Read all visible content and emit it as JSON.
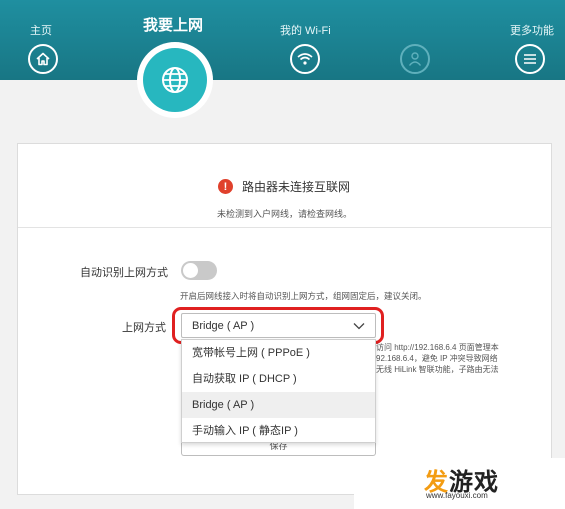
{
  "nav": {
    "home_label": "主页",
    "internet_label": "我要上网",
    "wifi_label": "我的 Wi-Fi",
    "more_label": "更多功能"
  },
  "status": {
    "title": "路由器未连接互联网",
    "subtitle": "未检测到入户网线，请检查网线。"
  },
  "form": {
    "auto_detect_label": "自动识别上网方式",
    "auto_detect_enabled": false,
    "auto_detect_hint": "开启后网线接入时将自动识别上网方式，组网固定后，建议关闭。",
    "method_label": "上网方式",
    "method_value": "Bridge ( AP )",
    "method_options": [
      "宽带帐号上网 ( PPPoE )",
      "自动获取 IP ( DHCP )",
      "Bridge ( AP )",
      "手动输入 IP ( 静态IP )"
    ],
    "selected_index": 2,
    "note_lines": [
      "访问 http://192.168.6.4 页面管理本",
      "92.168.6.4，避免 IP 冲突导致网络",
      "无线 HiLink 智联功能，子路由无法"
    ],
    "save_label": "保存"
  },
  "watermark": {
    "logo_part1": "发",
    "logo_part2": "游戏",
    "url": "www.fayouxi.com"
  },
  "colors": {
    "header": "#1a8594",
    "accent": "#27b7bf",
    "warning": "#e0412c",
    "highlight": "#e02020"
  }
}
